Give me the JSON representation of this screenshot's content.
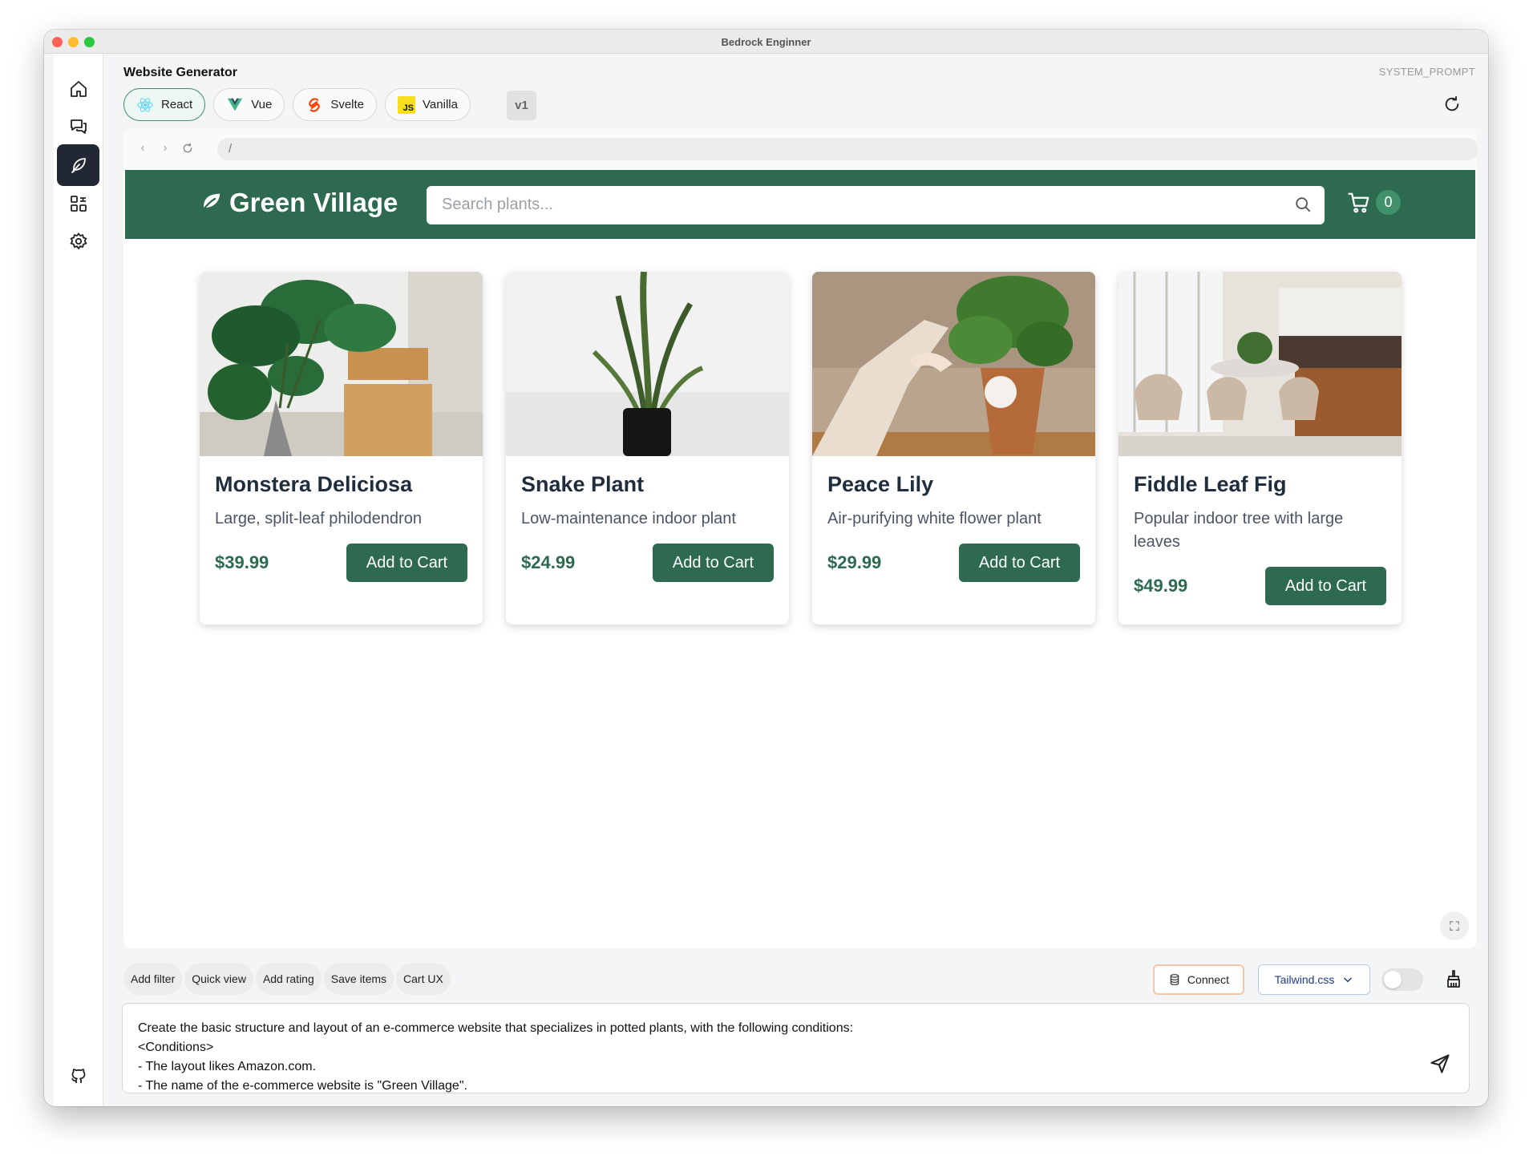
{
  "window": {
    "title": "Bedrock Enginner"
  },
  "app": {
    "section_title": "Website Generator",
    "system_prompt_label": "SYSTEM_PROMPT"
  },
  "sidebar": {
    "items": [
      {
        "name": "home",
        "icon": "home-icon",
        "active": false
      },
      {
        "name": "chat",
        "icon": "chat-icon",
        "active": false
      },
      {
        "name": "website-generator",
        "icon": "feather-icon",
        "active": true
      },
      {
        "name": "step-functions",
        "icon": "diagram-icon",
        "active": false
      },
      {
        "name": "settings",
        "icon": "gear-icon",
        "active": false
      }
    ],
    "footer_icon": "github-icon"
  },
  "frameworks": [
    {
      "label": "React",
      "icon": "react-icon",
      "selected": true
    },
    {
      "label": "Vue",
      "icon": "vue-icon",
      "selected": false
    },
    {
      "label": "Svelte",
      "icon": "svelte-icon",
      "selected": false
    },
    {
      "label": "Vanilla",
      "icon": "js-icon",
      "icon_text": "JS",
      "selected": false
    }
  ],
  "version_label": "v1",
  "browser": {
    "url": "/"
  },
  "site": {
    "brand": "Green Village",
    "search_placeholder": "Search plants...",
    "cart_count": "0",
    "colors": {
      "primary": "#2d6a4f",
      "badge": "#40916c"
    },
    "products": [
      {
        "name": "Monstera Deliciosa",
        "description": "Large, split-leaf philodendron",
        "price": "$39.99",
        "button": "Add to Cart"
      },
      {
        "name": "Snake Plant",
        "description": "Low-maintenance indoor plant",
        "price": "$24.99",
        "button": "Add to Cart"
      },
      {
        "name": "Peace Lily",
        "description": "Air-purifying white flower plant",
        "price": "$29.99",
        "button": "Add to Cart"
      },
      {
        "name": "Fiddle Leaf Fig",
        "description": "Popular indoor tree with large leaves",
        "price": "$49.99",
        "button": "Add to Cart"
      }
    ]
  },
  "suggestions": [
    "Add filter",
    "Quick view",
    "Add rating",
    "Save items",
    "Cart UX"
  ],
  "controls": {
    "connect_label": "Connect",
    "style_select": "Tailwind.css",
    "toggle_on": false
  },
  "prompt": {
    "lines": [
      "Create the basic structure and layout of an e-commerce website that specializes in potted plants, with the following conditions:",
      "<Conditions>",
      "- The layout likes Amazon.com.",
      "- The name of the e-commerce website is \"Green Village\"."
    ]
  }
}
